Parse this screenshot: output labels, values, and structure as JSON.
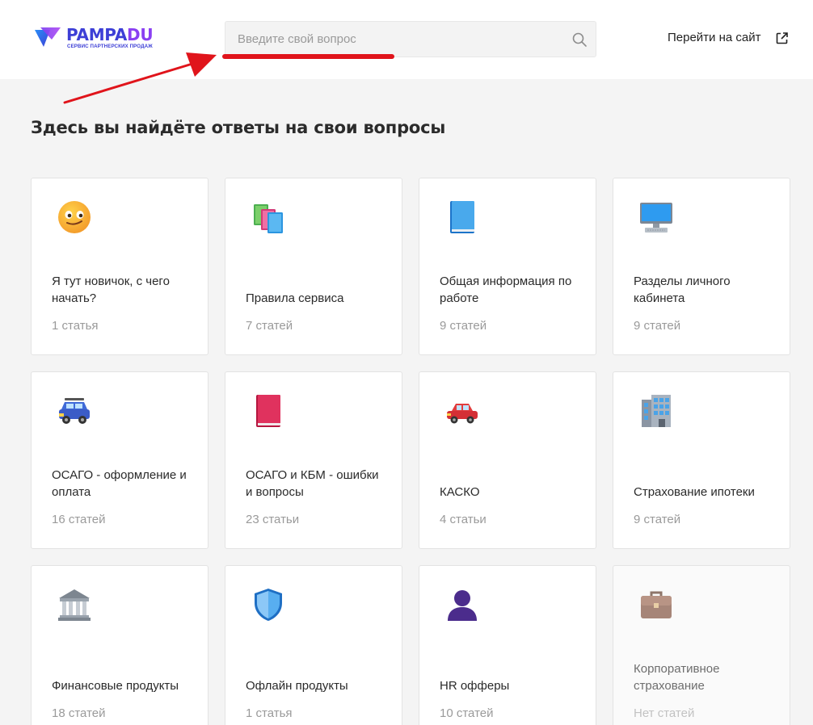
{
  "header": {
    "logo": {
      "word_part1": "PAMPA",
      "word_part2": "DU",
      "tagline": "СЕРВИС ПАРТНЕРСКИХ ПРОДАЖ"
    },
    "search": {
      "placeholder": "Введите свой вопрос",
      "value": "",
      "icon": "search-icon"
    },
    "site_link": {
      "label": "Перейти на сайт",
      "icon": "external-link-icon"
    }
  },
  "page_title": "Здесь вы найдёте ответы на свои вопросы",
  "annotation": {
    "color": "#e0141b"
  },
  "cards": [
    {
      "title": "Я тут новичок, с чего начать?",
      "count": "1 статья",
      "icon": "smiling-face-icon"
    },
    {
      "title": "Правила сервиса",
      "count": "7 статей",
      "icon": "books-icon"
    },
    {
      "title": "Общая информация по работе",
      "count": "9 статей",
      "icon": "blue-book-icon"
    },
    {
      "title": "Разделы личного кабинета",
      "count": "9 статей",
      "icon": "desktop-computer-icon"
    },
    {
      "title": "ОСАГО - оформление и оплата",
      "count": "16 статей",
      "icon": "suv-car-icon"
    },
    {
      "title": "ОСАГО и КБМ - ошибки и вопросы",
      "count": "23 статьи",
      "icon": "red-book-icon"
    },
    {
      "title": "КАСКО",
      "count": "4 статьи",
      "icon": "red-car-icon"
    },
    {
      "title": "Страхование ипотеки",
      "count": "9 статей",
      "icon": "office-building-icon"
    },
    {
      "title": "Финансовые продукты",
      "count": "18 статей",
      "icon": "bank-building-icon"
    },
    {
      "title": "Офлайн продукты",
      "count": "1 статья",
      "icon": "shield-icon"
    },
    {
      "title": "HR офферы",
      "count": "10 статей",
      "icon": "person-silhouette-icon"
    },
    {
      "title": "Корпоративное страхование",
      "count": "Нет статей",
      "icon": "briefcase-icon"
    }
  ],
  "colors": {
    "brand_blue": "#3d3fd6",
    "brand_purple": "#8a3ff2",
    "background": "#f4f4f4"
  }
}
